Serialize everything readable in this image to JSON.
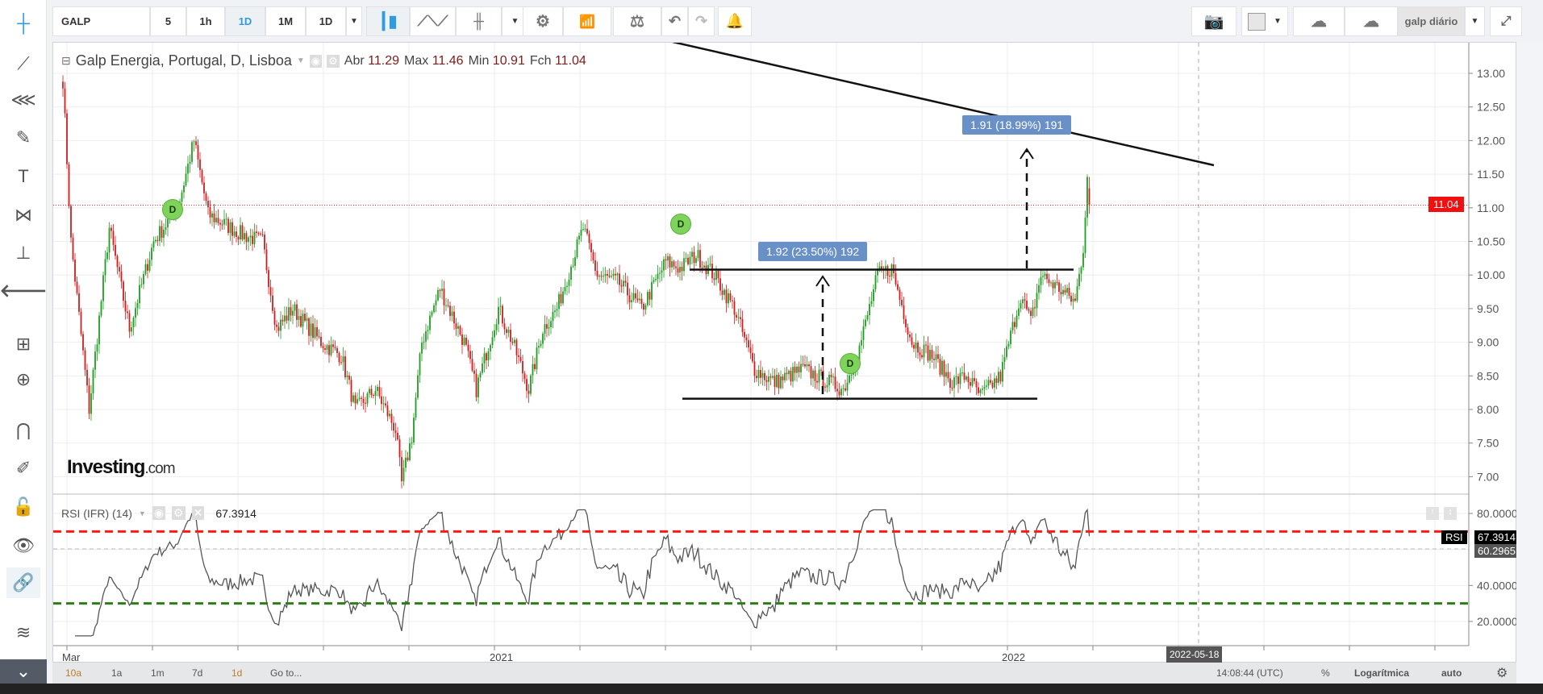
{
  "toolbar": {
    "symbol": "GALP",
    "intervals": [
      "5",
      "1h",
      "1D",
      "1M",
      "1D"
    ],
    "active_interval": "1D",
    "snapshot_name": "galp diário"
  },
  "legend": {
    "title": "Galp Energia, Portugal, D, Lisboa",
    "open_label": "Abr",
    "open": "11.29",
    "high_label": "Max",
    "high": "11.46",
    "low_label": "Min",
    "low": "10.91",
    "close_label": "Fch",
    "close": "11.04"
  },
  "rsi": {
    "title": "RSI (IFR) (14)",
    "value": "67.3914",
    "tag": "RSI",
    "axis_value": "67.3914",
    "ma_value": "60.2965",
    "overbought": 70,
    "oversold": 30
  },
  "price_axis": {
    "ticks": [
      "13.00",
      "12.50",
      "12.00",
      "11.50",
      "11.00",
      "10.50",
      "10.00",
      "9.50",
      "9.00",
      "8.50",
      "8.00",
      "7.50",
      "7.00"
    ],
    "current": "11.04"
  },
  "rsi_axis": {
    "ticks": [
      "80.0000",
      "40.0000",
      "20.0000"
    ]
  },
  "time_axis": {
    "labels": [
      "Mar",
      "2021",
      "2022"
    ],
    "cursor": "2022-05-18"
  },
  "annotations": {
    "measure1": "1.92 (23.50%) 192",
    "measure2": "1.91 (18.99%) 191",
    "dividend": "D"
  },
  "logo": "Investing.com",
  "bottombar": {
    "ranges": [
      "10a",
      "1a",
      "1m",
      "7d",
      "1d",
      "Go to..."
    ],
    "time": "14:08:44 (UTC)",
    "percent": "%",
    "log": "Logarítmica",
    "auto": "auto"
  },
  "colors": {
    "up": "#1e9e1e",
    "down": "#d11c1c",
    "overbought": "#ff1a1a",
    "oversold": "#2e7d1a",
    "accent": "#2f9be0",
    "label": "#6a90c8"
  },
  "chart_data": {
    "type": "candlestick",
    "price_path": [
      [
        0,
        12.9
      ],
      [
        4,
        10.5
      ],
      [
        13,
        8.0
      ],
      [
        23,
        10.7
      ],
      [
        33,
        9.2
      ],
      [
        45,
        10.5
      ],
      [
        57,
        11.0
      ],
      [
        65,
        12.0
      ],
      [
        72,
        10.9
      ],
      [
        89,
        10.6
      ],
      [
        99,
        10.5
      ],
      [
        106,
        9.2
      ],
      [
        114,
        9.5
      ],
      [
        128,
        9.0
      ],
      [
        138,
        8.8
      ],
      [
        145,
        8.0
      ],
      [
        155,
        8.3
      ],
      [
        165,
        7.7
      ],
      [
        168,
        6.9
      ],
      [
        173,
        7.6
      ],
      [
        178,
        9.0
      ],
      [
        187,
        9.8
      ],
      [
        199,
        9.0
      ],
      [
        205,
        8.3
      ],
      [
        216,
        9.5
      ],
      [
        223,
        9.0
      ],
      [
        231,
        8.3
      ],
      [
        238,
        9.2
      ],
      [
        245,
        9.5
      ],
      [
        258,
        10.7
      ],
      [
        265,
        10.0
      ],
      [
        275,
        9.9
      ],
      [
        287,
        9.5
      ],
      [
        299,
        10.2
      ],
      [
        306,
        10.1
      ],
      [
        314,
        10.3
      ],
      [
        323,
        10.0
      ],
      [
        333,
        9.5
      ],
      [
        343,
        8.6
      ],
      [
        353,
        8.4
      ],
      [
        367,
        8.6
      ],
      [
        387,
        8.3
      ],
      [
        394,
        8.8
      ],
      [
        404,
        10.0
      ],
      [
        411,
        10.1
      ],
      [
        421,
        9.0
      ],
      [
        431,
        8.8
      ],
      [
        441,
        8.4
      ],
      [
        448,
        8.5
      ],
      [
        455,
        8.2
      ],
      [
        465,
        8.5
      ],
      [
        475,
        9.7
      ],
      [
        480,
        9.3
      ],
      [
        485,
        10.0
      ],
      [
        494,
        9.8
      ],
      [
        502,
        9.6
      ],
      [
        506,
        10.4
      ],
      [
        508,
        11.5
      ],
      [
        509,
        11.04
      ]
    ],
    "ylim": [
      6.8,
      13.4
    ]
  }
}
